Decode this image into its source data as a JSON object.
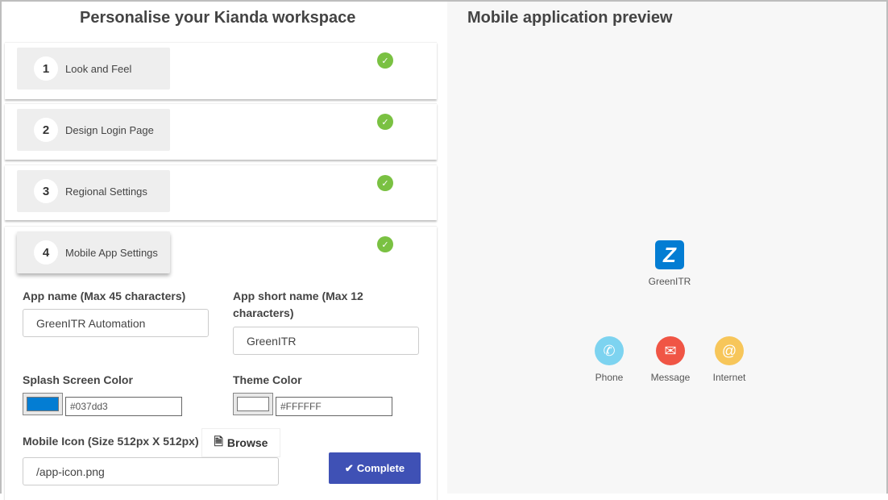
{
  "left_title": "Personalise your Kianda workspace",
  "right_title": "Mobile application preview",
  "steps": [
    {
      "num": "1",
      "label": "Look and Feel",
      "complete": true
    },
    {
      "num": "2",
      "label": "Design Login Page",
      "complete": true
    },
    {
      "num": "3",
      "label": "Regional Settings",
      "complete": true
    },
    {
      "num": "4",
      "label": "Mobile App Settings",
      "complete": true
    }
  ],
  "form": {
    "app_name_label": "App name (Max 45 characters)",
    "app_name_value": "GreenITR Automation",
    "short_name_label": "App short name (Max 12 characters)",
    "short_name_value": "GreenITR",
    "splash_label": "Splash Screen Color",
    "splash_value": "#037dd3",
    "theme_label": "Theme Color",
    "theme_value": "#FFFFFF",
    "icon_label": "Mobile Icon (Size 512px X 512px)",
    "browse_label": "Browse",
    "icon_value": "/app-icon.png",
    "complete_label": "Complete"
  },
  "preview": {
    "app_label": "GreenITR",
    "apps": [
      {
        "label": "Phone",
        "icon": "phone-icon",
        "color": "#7dd3f0"
      },
      {
        "label": "Message",
        "icon": "envelope-icon",
        "color": "#f05545"
      },
      {
        "label": "Internet",
        "icon": "at-icon",
        "color": "#f7c65a"
      }
    ]
  },
  "colors": {
    "accent": "#3f51b5",
    "check": "#7ac142",
    "app_icon": "#037dd3"
  }
}
